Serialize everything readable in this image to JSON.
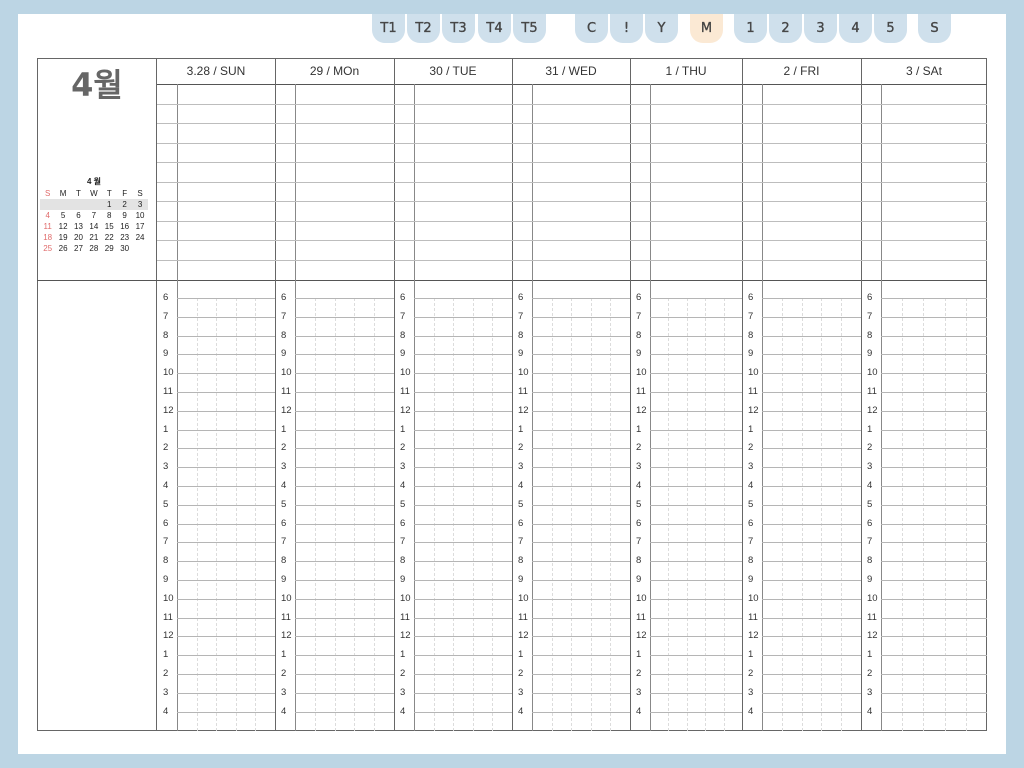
{
  "tabs": [
    {
      "label": "T1",
      "active": false
    },
    {
      "label": "T2",
      "active": false
    },
    {
      "label": "T3",
      "active": false
    },
    {
      "label": "T4",
      "active": false
    },
    {
      "label": "T5",
      "active": false
    },
    {
      "label": "C",
      "active": false
    },
    {
      "label": "!",
      "active": false
    },
    {
      "label": "Y",
      "active": false
    },
    {
      "label": "M",
      "active": true
    },
    {
      "label": "1",
      "active": false
    },
    {
      "label": "2",
      "active": false
    },
    {
      "label": "3",
      "active": false
    },
    {
      "label": "4",
      "active": false
    },
    {
      "label": "5",
      "active": false
    },
    {
      "label": "S",
      "active": false
    }
  ],
  "colors": {
    "background": "#bcd5e4",
    "tab": "#cfe0ec",
    "tab_active": "#fbe9d4",
    "sunday": "#e06c6c"
  },
  "month_title": "4월",
  "mini_calendar": {
    "title": "4 월",
    "weekdays": [
      "S",
      "M",
      "T",
      "W",
      "T",
      "F",
      "S"
    ],
    "weeks": [
      [
        "",
        "",
        "",
        "",
        "1",
        "2",
        "3"
      ],
      [
        "4",
        "5",
        "6",
        "7",
        "8",
        "9",
        "10"
      ],
      [
        "11",
        "12",
        "13",
        "14",
        "15",
        "16",
        "17"
      ],
      [
        "18",
        "19",
        "20",
        "21",
        "22",
        "23",
        "24"
      ],
      [
        "25",
        "26",
        "27",
        "28",
        "29",
        "30",
        ""
      ]
    ]
  },
  "days": [
    {
      "label": "3.28   / SUN"
    },
    {
      "label": "29  / MOn"
    },
    {
      "label": "30  / TUE"
    },
    {
      "label": "31  / WED"
    },
    {
      "label": "1    / THU"
    },
    {
      "label": "2  / FRI"
    },
    {
      "label": "3   / SAt"
    }
  ],
  "hours": [
    "6",
    "7",
    "8",
    "9",
    "10",
    "11",
    "12",
    "1",
    "2",
    "3",
    "4",
    "5",
    "6",
    "7",
    "8",
    "9",
    "10",
    "11",
    "12",
    "1",
    "2",
    "3",
    "4"
  ]
}
